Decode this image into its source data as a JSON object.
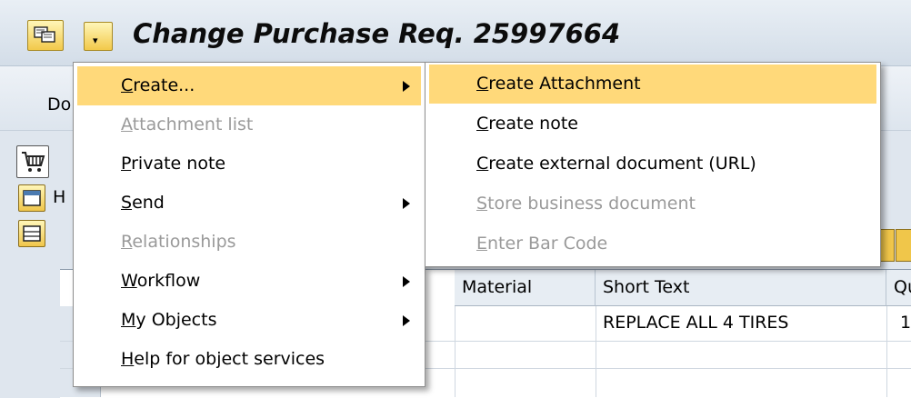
{
  "window": {
    "title": "Change Purchase Req. 25997664"
  },
  "toolbar": {
    "doc_overview_label": "Do"
  },
  "header": {
    "label": "H"
  },
  "grid": {
    "columns": [
      "Material",
      "Short Text",
      "Qu"
    ],
    "rows": [
      {
        "material": "",
        "short_text": "REPLACE ALL 4 TIRES",
        "qty": "1"
      }
    ]
  },
  "main_menu": {
    "items": [
      {
        "first": "C",
        "rest": "reate...",
        "enabled": true,
        "submenu": true,
        "highlighted": true
      },
      {
        "first": "A",
        "rest": "ttachment list",
        "enabled": false,
        "submenu": false
      },
      {
        "first": "P",
        "rest": "rivate note",
        "enabled": true,
        "submenu": false
      },
      {
        "first": "S",
        "rest": "end",
        "enabled": true,
        "submenu": true
      },
      {
        "first": "R",
        "rest": "elationships",
        "enabled": false,
        "submenu": false
      },
      {
        "first": "W",
        "rest": "orkflow",
        "enabled": true,
        "submenu": true
      },
      {
        "first": "M",
        "rest": "y Objects",
        "enabled": true,
        "submenu": true
      },
      {
        "first": "H",
        "rest": "elp for object services",
        "enabled": true,
        "submenu": false
      }
    ]
  },
  "sub_menu": {
    "items": [
      {
        "first": "C",
        "rest": "reate Attachment",
        "enabled": true,
        "highlighted": true
      },
      {
        "first": "C",
        "rest": "reate note",
        "enabled": true
      },
      {
        "first": "C",
        "rest": "reate external document (URL)",
        "enabled": true
      },
      {
        "first": "S",
        "rest": "tore business document",
        "enabled": false
      },
      {
        "first": "E",
        "rest": "nter Bar Code",
        "enabled": false
      }
    ]
  },
  "colors": {
    "highlight": "#ffd97a",
    "disabled_text": "#9a9a9a",
    "title_bg": "#dfe6ee"
  }
}
